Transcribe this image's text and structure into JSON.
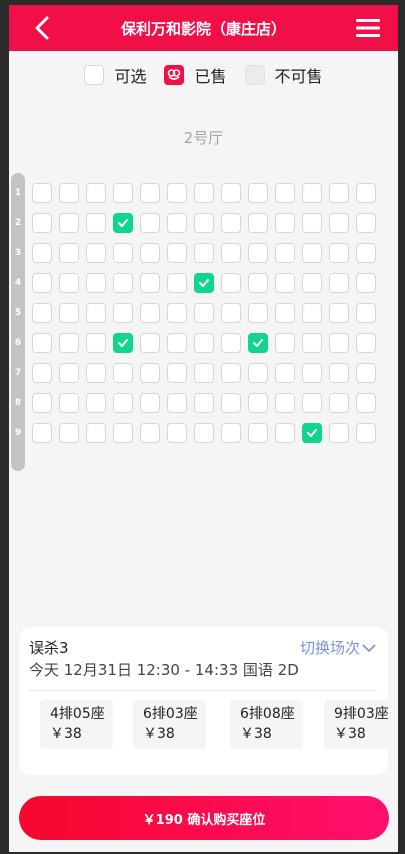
{
  "header": {
    "title": "保利万和影院（康庄店）"
  },
  "legend": {
    "available": "可选",
    "sold": "已售",
    "unavailable": "不可售"
  },
  "hall": "2号厅",
  "seats": {
    "rows": 9,
    "cols": 13,
    "row_labels": [
      "1",
      "2",
      "3",
      "4",
      "5",
      "6",
      "7",
      "8",
      "9"
    ],
    "selected": [
      [
        2,
        4
      ],
      [
        4,
        7
      ],
      [
        6,
        4
      ],
      [
        6,
        9
      ],
      [
        9,
        11
      ]
    ]
  },
  "movie": {
    "title": "误杀3",
    "switch_label": "切换场次",
    "showtime": "今天 12月31日 12:30 - 14:33 国语 2D"
  },
  "tickets": [
    {
      "seat": "4排05座",
      "price": "￥38"
    },
    {
      "seat": "6排03座",
      "price": "￥38"
    },
    {
      "seat": "6排08座",
      "price": "￥38"
    },
    {
      "seat": "9排03座",
      "price": "￥38"
    }
  ],
  "buy_button": "￥190 确认购买座位",
  "colors": {
    "brand": "#f00f47",
    "selected_seat": "#10d58c",
    "link": "#7b8fe4"
  }
}
